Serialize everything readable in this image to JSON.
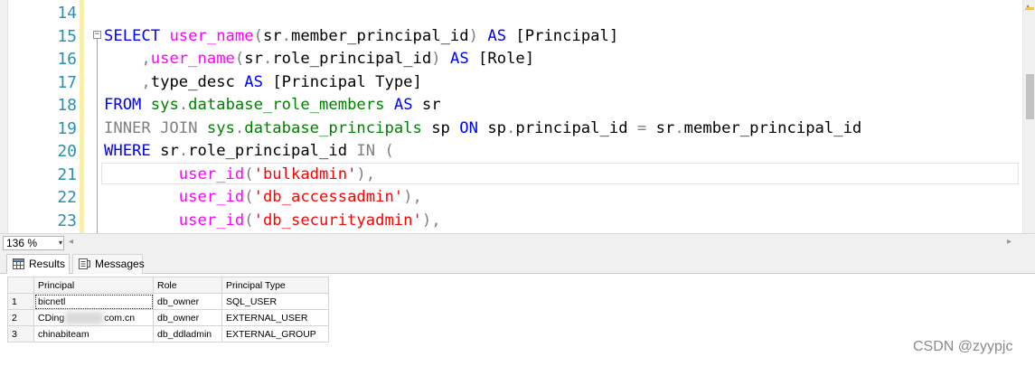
{
  "editor": {
    "lines": [
      {
        "no": "14",
        "tokens": []
      },
      {
        "no": "15",
        "tokens": [
          {
            "t": "SELECT",
            "c": "kw"
          },
          {
            "t": " "
          },
          {
            "t": "user_name",
            "c": "fn"
          },
          {
            "t": "(",
            "c": "gray"
          },
          {
            "t": "sr"
          },
          {
            "t": ".",
            "c": "gray"
          },
          {
            "t": "member_principal_id"
          },
          {
            "t": ")",
            "c": "gray"
          },
          {
            "t": " "
          },
          {
            "t": "AS",
            "c": "kw"
          },
          {
            "t": " [Principal]"
          }
        ]
      },
      {
        "no": "16",
        "tokens": [
          {
            "t": "    "
          },
          {
            "t": ",",
            "c": "gray"
          },
          {
            "t": "user_name",
            "c": "fn"
          },
          {
            "t": "(",
            "c": "gray"
          },
          {
            "t": "sr"
          },
          {
            "t": ".",
            "c": "gray"
          },
          {
            "t": "role_principal_id"
          },
          {
            "t": ")",
            "c": "gray"
          },
          {
            "t": " "
          },
          {
            "t": "AS",
            "c": "kw"
          },
          {
            "t": " [Role]"
          }
        ]
      },
      {
        "no": "17",
        "tokens": [
          {
            "t": "    "
          },
          {
            "t": ",",
            "c": "gray"
          },
          {
            "t": "type_desc"
          },
          {
            "t": " "
          },
          {
            "t": "AS",
            "c": "kw"
          },
          {
            "t": " [Principal Type]"
          }
        ]
      },
      {
        "no": "18",
        "tokens": [
          {
            "t": "FROM",
            "c": "kw"
          },
          {
            "t": " "
          },
          {
            "t": "sys",
            "c": "sys"
          },
          {
            "t": ".",
            "c": "gray"
          },
          {
            "t": "database_role_members",
            "c": "sys"
          },
          {
            "t": " "
          },
          {
            "t": "AS",
            "c": "kw"
          },
          {
            "t": " sr"
          }
        ]
      },
      {
        "no": "19",
        "tokens": [
          {
            "t": "INNER JOIN",
            "c": "gray"
          },
          {
            "t": " "
          },
          {
            "t": "sys",
            "c": "sys"
          },
          {
            "t": ".",
            "c": "gray"
          },
          {
            "t": "database_principals",
            "c": "sys"
          },
          {
            "t": " sp "
          },
          {
            "t": "ON",
            "c": "kw"
          },
          {
            "t": " sp"
          },
          {
            "t": ".",
            "c": "gray"
          },
          {
            "t": "principal_id "
          },
          {
            "t": "=",
            "c": "gray"
          },
          {
            "t": " sr"
          },
          {
            "t": ".",
            "c": "gray"
          },
          {
            "t": "member_principal_id"
          }
        ]
      },
      {
        "no": "20",
        "tokens": [
          {
            "t": "WHERE",
            "c": "kw"
          },
          {
            "t": " sr"
          },
          {
            "t": ".",
            "c": "gray"
          },
          {
            "t": "role_principal_id "
          },
          {
            "t": "IN",
            "c": "gray"
          },
          {
            "t": " "
          },
          {
            "t": "(",
            "c": "gray"
          }
        ]
      },
      {
        "no": "21",
        "tokens": [
          {
            "t": "        "
          },
          {
            "t": "user_id",
            "c": "fn"
          },
          {
            "t": "(",
            "c": "gray"
          },
          {
            "t": "'bulkadmin'",
            "c": "str"
          },
          {
            "t": ")",
            "c": "gray"
          },
          {
            "t": ",",
            "c": "gray"
          }
        ]
      },
      {
        "no": "22",
        "tokens": [
          {
            "t": "        "
          },
          {
            "t": "user_id",
            "c": "fn"
          },
          {
            "t": "(",
            "c": "gray"
          },
          {
            "t": "'db_accessadmin'",
            "c": "str"
          },
          {
            "t": ")",
            "c": "gray"
          },
          {
            "t": ",",
            "c": "gray"
          }
        ]
      },
      {
        "no": "23",
        "tokens": [
          {
            "t": "        "
          },
          {
            "t": "user_id",
            "c": "fn"
          },
          {
            "t": "(",
            "c": "gray"
          },
          {
            "t": "'db_securityadmin'",
            "c": "str"
          },
          {
            "t": ")",
            "c": "gray"
          },
          {
            "t": ",",
            "c": "gray"
          }
        ]
      }
    ],
    "fold_symbol": "−"
  },
  "zoom": {
    "value": "136 %",
    "arrow": "▾"
  },
  "tabs": [
    {
      "label": "Results",
      "active": true
    },
    {
      "label": "Messages",
      "active": false
    }
  ],
  "grid": {
    "headers": [
      "Principal",
      "Role",
      "Principal Type"
    ],
    "rows": [
      {
        "num": "1",
        "principal": "bicnetl",
        "role": "db_owner",
        "type": "SQL_USER"
      },
      {
        "num": "2",
        "principal_pre": "CDing",
        "principal_post": "com.cn",
        "role": "db_owner",
        "type": "EXTERNAL_USER"
      },
      {
        "num": "3",
        "principal": "chinabiteam",
        "role": "db_ddladmin",
        "type": "EXTERNAL_GROUP"
      }
    ]
  },
  "watermark": "CSDN @zyypjc",
  "colors": {
    "keyword": "#0000ff",
    "function": "#ff00ff",
    "operator": "#808080",
    "system_object": "#008000",
    "string": "#ff0000",
    "line_number": "#2b91af"
  },
  "icons": {
    "results_tab": "grid-icon",
    "messages_tab": "messages-icon"
  }
}
